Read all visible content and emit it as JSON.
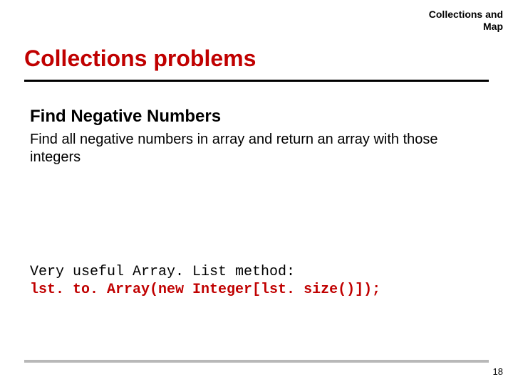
{
  "header": {
    "line1": "Collections and",
    "line2": "Map"
  },
  "title": "Collections problems",
  "section": {
    "heading": "Find Negative Numbers",
    "body": "Find all negative numbers in array and return an array with those integers"
  },
  "code": {
    "line1": "Very useful Array. List method:",
    "line2": "lst. to. Array(new Integer[lst. size()]);"
  },
  "page_number": "18"
}
